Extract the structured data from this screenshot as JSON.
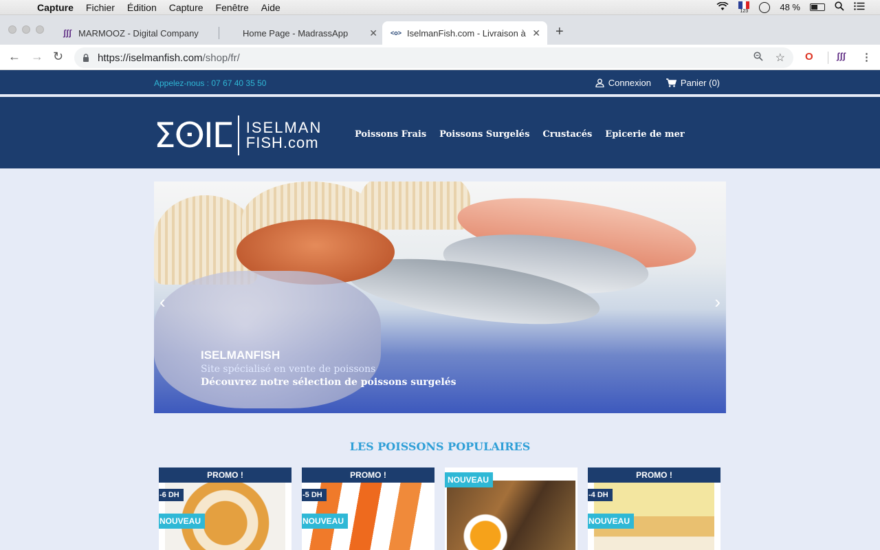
{
  "menubar": {
    "items": [
      "Capture",
      "Fichier",
      "Édition",
      "Capture",
      "Fenêtre",
      "Aide"
    ],
    "flag_label": "123",
    "battery": "48 %"
  },
  "tabs": [
    {
      "title": "MARMOOZ - Digital Company",
      "icon": "marmooz-icon"
    },
    {
      "title": "Home Page - MadrassApp",
      "icon": ""
    },
    {
      "title": "IselmanFish.com - Livraison à",
      "icon": "fish-icon"
    }
  ],
  "address": {
    "domain": "https://iselmanfish.com",
    "path": "/shop/fr/"
  },
  "site": {
    "phone": "Appelez-nous : 07 67 40 35 50",
    "login": "Connexion",
    "cart": "Panier (0)",
    "logo_line1": "ISELMAN",
    "logo_line2": "FISH.com",
    "nav": [
      "Poissons Frais",
      "Poissons Surgelés",
      "Crustacés",
      "Epicerie de mer"
    ]
  },
  "hero": {
    "title": "ISELMANFISH",
    "subtitle1": "Site spécialisé en vente de poissons",
    "subtitle2": "Découvrez notre sélection de poissons surgelés"
  },
  "section": {
    "title": "LES POISSONS POPULAIRES"
  },
  "products": [
    {
      "promo": "PROMO !",
      "discount": "-6 DH",
      "new": "NOUVEAU"
    },
    {
      "promo": "PROMO !",
      "discount": "-5 DH",
      "new": "NOUVEAU"
    },
    {
      "promo": "",
      "discount": "",
      "new": "NOUVEAU"
    },
    {
      "promo": "PROMO !",
      "discount": "-4 DH",
      "new": "NOUVEAU"
    }
  ],
  "colors": {
    "brand_navy": "#1c3d6e",
    "accent_cyan": "#2fb8d6",
    "section_blue": "#2f9fd7",
    "page_bg": "#e6ebf7"
  }
}
